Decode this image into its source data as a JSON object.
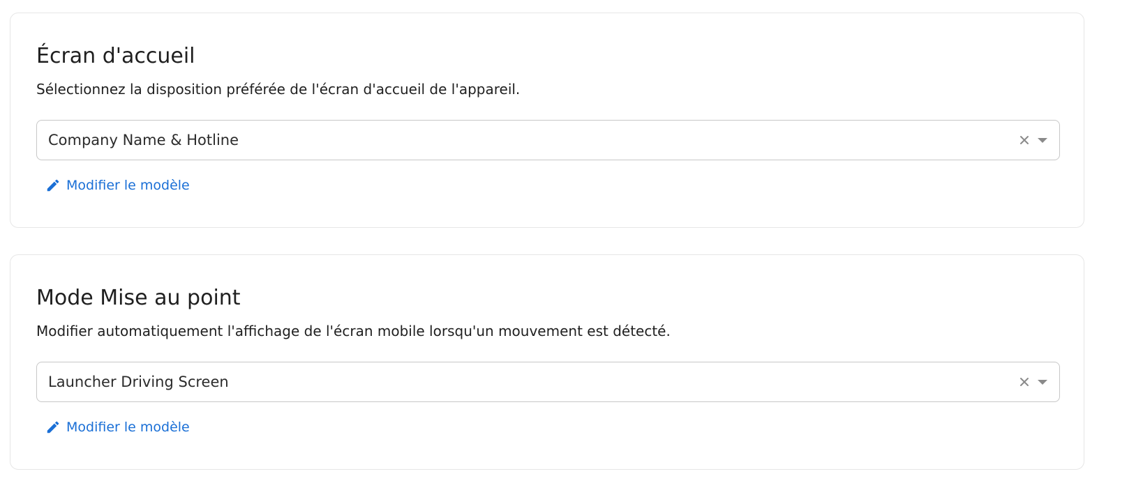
{
  "sections": [
    {
      "title": "Écran d'accueil",
      "description": "Sélectionnez la disposition préférée de l'écran d'accueil de l'appareil.",
      "select_value": "Company Name & Hotline",
      "edit_label": "Modifier le modèle"
    },
    {
      "title": "Mode Mise au point",
      "description": "Modifier automatiquement l'affichage de l'écran mobile lorsqu'un mouvement est détecté.",
      "select_value": "Launcher Driving Screen",
      "edit_label": "Modifier le modèle"
    }
  ],
  "icons": {
    "clear": "close-icon",
    "dropdown": "chevron-down-icon",
    "edit": "pencil-icon"
  },
  "colors": {
    "link": "#1a6fd6",
    "border": "#c7c7c7",
    "card_border": "#e6e6e6",
    "icon_gray": "#8a8a8a"
  }
}
